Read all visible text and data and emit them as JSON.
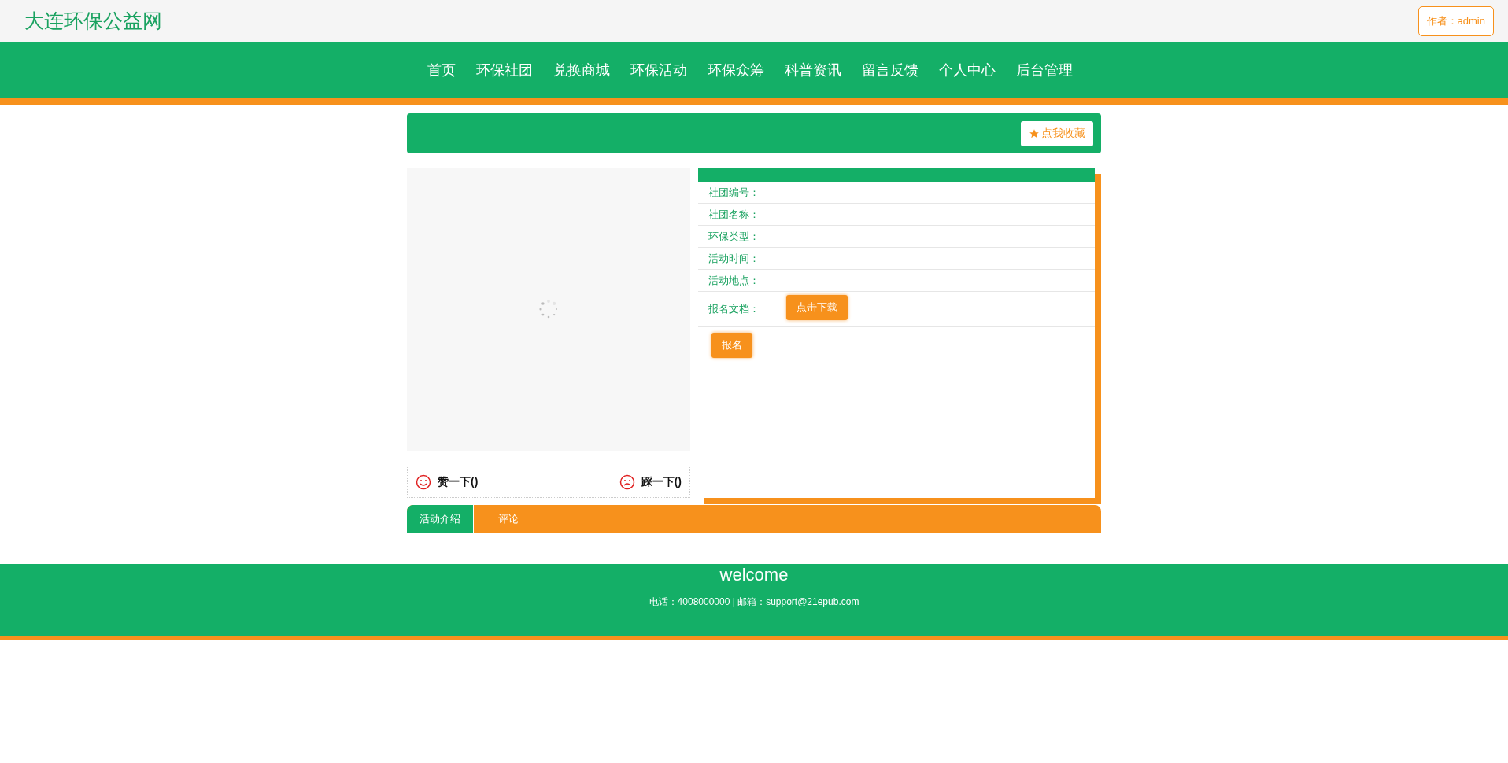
{
  "header": {
    "site_title": "大连环保公益网",
    "author_button": "作者：admin"
  },
  "nav": [
    "首页",
    "环保社团",
    "兑换商城",
    "环保活动",
    "环保众筹",
    "科普资讯",
    "留言反馈",
    "个人中心",
    "后台管理"
  ],
  "banner": {
    "collect_button": "点我收藏"
  },
  "image": {
    "loading": true
  },
  "details": {
    "fields": [
      {
        "label": "社团编号："
      },
      {
        "label": "社团名称："
      },
      {
        "label": "环保类型："
      },
      {
        "label": "活动时间："
      },
      {
        "label": "活动地点："
      }
    ],
    "document": {
      "label": "报名文档：",
      "button": "点击下载"
    },
    "signup_button": "报名"
  },
  "votes": {
    "like": "赞一下()",
    "dislike": "踩一下()"
  },
  "tabs": [
    {
      "label": "活动介绍",
      "selected": true
    },
    {
      "label": "评论",
      "selected": false
    }
  ],
  "footer": {
    "title": "welcome",
    "contact": "电话：4008000000 | 邮箱：support@21epub.com"
  }
}
